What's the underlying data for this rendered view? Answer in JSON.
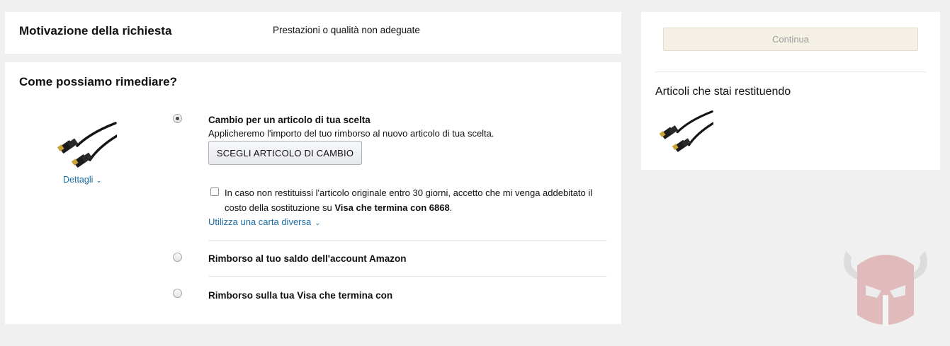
{
  "reason": {
    "title": "Motivazione della richiesta",
    "value": "Prestazioni o qualità non adeguate"
  },
  "remedy": {
    "title": "Come possiamo rimediare?",
    "product_details_link": "Dettagli",
    "options": [
      {
        "title": "Cambio per un articolo di tua scelta",
        "description": "Applicheremo l'importo del tuo rimborso al nuovo articolo di tua scelta.",
        "button_label": "SCEGLI ARTICOLO DI CAMBIO",
        "checkbox_text_before": "In caso non restituissi l'articolo originale entro 30 giorni, accetto che mi venga addebitato il costo della sostituzione su ",
        "checkbox_text_bold": "Visa che termina con 6868",
        "checkbox_text_after": ".",
        "checkbox_checked": false,
        "alt_card_link": "Utilizza una carta diversa",
        "selected": true
      },
      {
        "title": "Rimborso al tuo saldo dell'account Amazon",
        "selected": false
      },
      {
        "title": "Rimborso sulla tua Visa che termina con",
        "selected": false
      }
    ]
  },
  "sidebar": {
    "continue_label": "Continua",
    "returning_title": "Articoli che stai restituendo"
  },
  "icons": {
    "product": "hdmi-cable-image",
    "chevron": "chevron-down-icon",
    "watermark": "helmet-logo-watermark"
  }
}
